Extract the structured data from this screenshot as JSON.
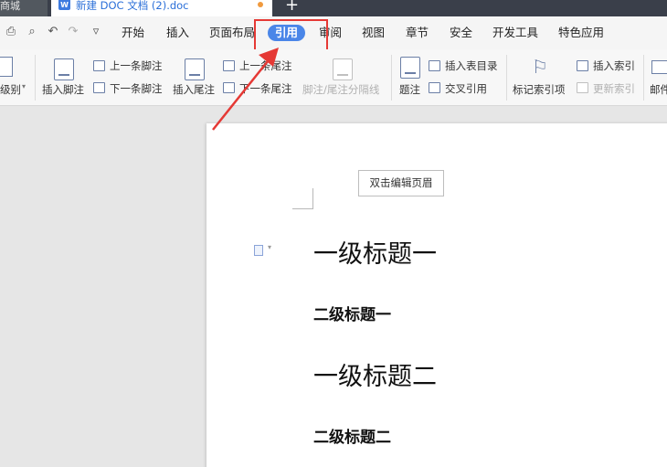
{
  "titlebar": {
    "left_tab": "商城",
    "doc_tab": "新建 DOC 文档 (2).doc",
    "doc_icon": "W",
    "new_tab": "+"
  },
  "menu": {
    "items": [
      "开始",
      "插入",
      "页面布局",
      "引用",
      "审阅",
      "视图",
      "章节",
      "安全",
      "开发工具",
      "特色应用"
    ],
    "active": "引用"
  },
  "ribbon": {
    "level": "级别",
    "insert_footnote": "插入脚注",
    "prev_footnote": "上一条脚注",
    "next_footnote": "下一条脚注",
    "insert_endnote": "插入尾注",
    "prev_endnote": "上一条尾注",
    "next_endnote": "下一条尾注",
    "separator": "脚注/尾注分隔线",
    "caption": "题注",
    "insert_toc": "插入表目录",
    "cross_ref": "交叉引用",
    "mark_index": "标记索引项",
    "insert_index": "插入索引",
    "update_index": "更新索引",
    "mail": "邮件"
  },
  "document": {
    "header_tip": "双击编辑页眉",
    "headings": [
      {
        "level": 1,
        "text": "一级标题一"
      },
      {
        "level": 2,
        "text": "二级标题一"
      },
      {
        "level": 1,
        "text": "一级标题二"
      },
      {
        "level": 2,
        "text": "二级标题二"
      }
    ]
  },
  "colors": {
    "active_tab_bg": "#4a86e8",
    "highlight": "#e53935",
    "arrow": "#e53935"
  }
}
